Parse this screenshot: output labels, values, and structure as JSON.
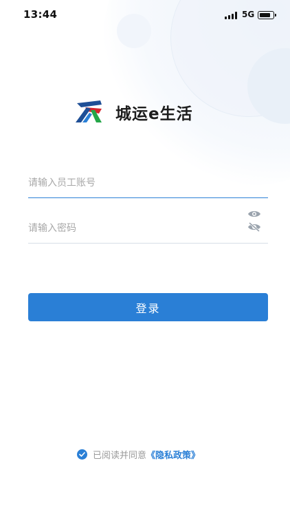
{
  "status_bar": {
    "time": "13:44",
    "network": "5G",
    "icons": [
      "signal-icon",
      "battery-icon"
    ]
  },
  "app": {
    "name": "城运e生活",
    "logo_icon": "city-logo-icon",
    "colors": {
      "blue": "#2a7fd6",
      "red": "#d7262e",
      "green": "#24a648",
      "navy": "#1f4f96"
    }
  },
  "form": {
    "username_placeholder": "请输入员工账号",
    "username_value": "",
    "password_placeholder": "请输入密码",
    "password_value": "",
    "show_password_icon": "eye-open-icon",
    "hide_password_icon": "eye-closed-icon"
  },
  "login_button": {
    "label": "登录"
  },
  "agreement": {
    "checked": true,
    "text": "已阅读并同意",
    "link_text": "《隐私政策》"
  }
}
